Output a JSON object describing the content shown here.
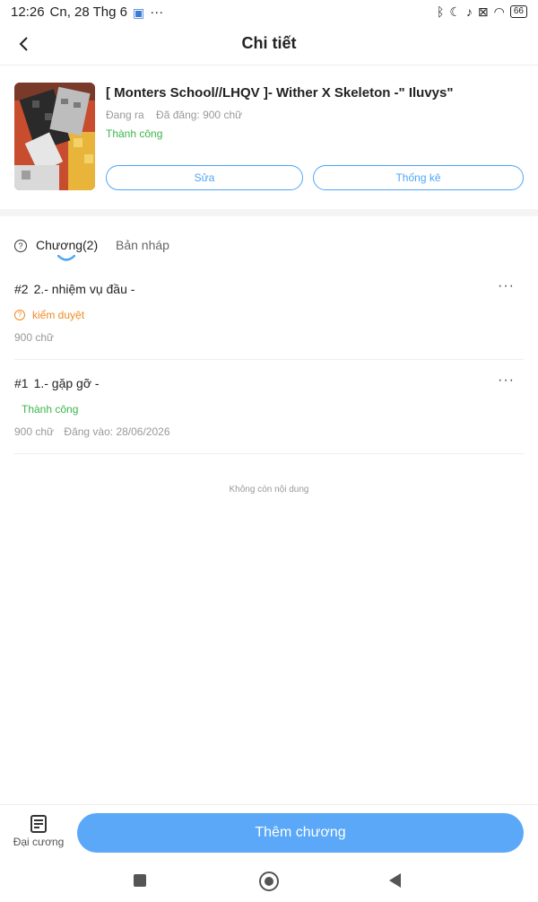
{
  "status": {
    "time": "12:26",
    "date": "Cn, 28 Thg 6",
    "more": "···",
    "battery": "66"
  },
  "header": {
    "title": "Chi tiết"
  },
  "book": {
    "title": "[ Monters School//LHQV ]- Wither X Skeleton -\" Iluvys\"",
    "state": "Đang ra",
    "word_count": "Đã đăng: 900 chữ",
    "status": "Thành công",
    "edit_label": "Sửa",
    "stats_label": "Thống kê"
  },
  "tabs": {
    "chapters_label": "Chương(2)",
    "drafts_label": "Bản nháp"
  },
  "chapters": [
    {
      "number": "#2",
      "title": "2.- nhiệm vụ đầu -",
      "status": "kiểm duyệt",
      "words": "900 chữ",
      "published": ""
    },
    {
      "number": "#1",
      "title": "1.- gặp gỡ -",
      "status": "Thành công",
      "words": "900 chữ",
      "published": "Đăng vào:   28/06/2026"
    }
  ],
  "list_end": "Không còn nội dung",
  "bottom": {
    "outline_label": "Đại cương",
    "add_chapter_label": "Thêm chương"
  },
  "colors": {
    "accent": "#5aa8f7",
    "success": "#3bb54a",
    "review": "#f08a24"
  }
}
